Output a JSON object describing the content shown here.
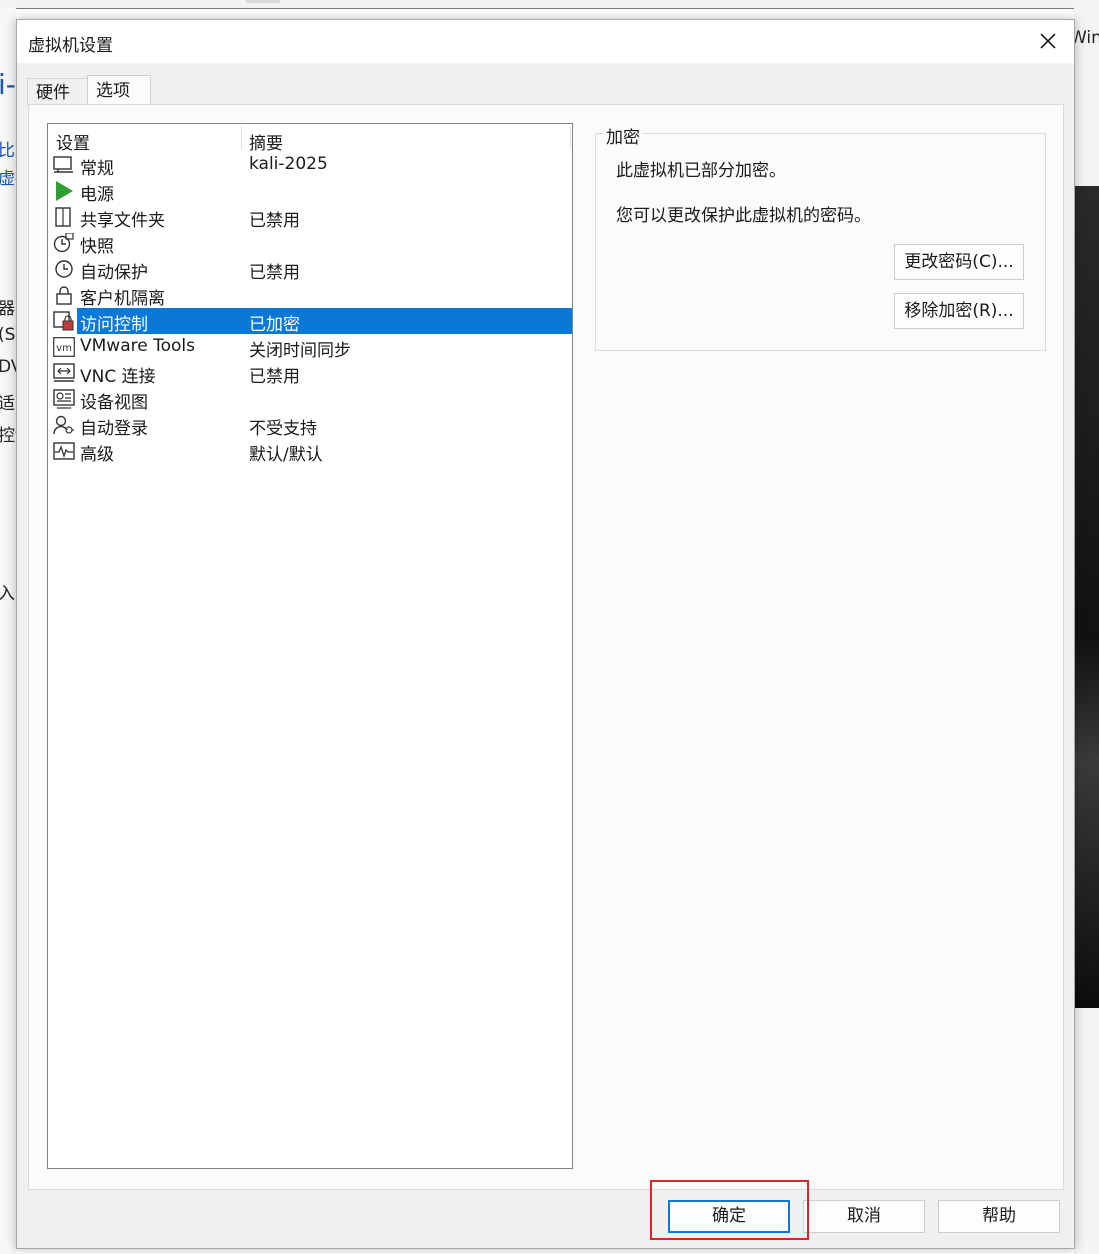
{
  "background": {
    "left_fragments": [
      "i-",
      "比虚",
      "虚拟",
      "器",
      "(S",
      "DV",
      "适配",
      "控制",
      "入"
    ],
    "right_fragment": "Wind"
  },
  "dialog": {
    "title": "虚拟机设置",
    "tabs": [
      {
        "label": "硬件",
        "active": false
      },
      {
        "label": "选项",
        "active": true
      }
    ],
    "list": {
      "header": {
        "setting": "设置",
        "summary": "摘要"
      },
      "rows": [
        {
          "name": "常规",
          "summary": "kali-2025",
          "icon": "general-icon"
        },
        {
          "name": "电源",
          "summary": "",
          "icon": "power-icon"
        },
        {
          "name": "共享文件夹",
          "summary": "已禁用",
          "icon": "shared-folder-icon"
        },
        {
          "name": "快照",
          "summary": "",
          "icon": "snapshot-icon"
        },
        {
          "name": "自动保护",
          "summary": "已禁用",
          "icon": "autoprotect-icon"
        },
        {
          "name": "客户机隔离",
          "summary": "",
          "icon": "lock-icon"
        },
        {
          "name": "访问控制",
          "summary": "已加密",
          "icon": "access-control-icon",
          "selected": true
        },
        {
          "name": "VMware Tools",
          "summary": "关闭时间同步",
          "icon": "vmware-tools-icon"
        },
        {
          "name": "VNC 连接",
          "summary": "已禁用",
          "icon": "vnc-icon"
        },
        {
          "name": "设备视图",
          "summary": "",
          "icon": "device-view-icon"
        },
        {
          "name": "自动登录",
          "summary": "不受支持",
          "icon": "autologin-icon"
        },
        {
          "name": "高级",
          "summary": "默认/默认",
          "icon": "advanced-icon"
        }
      ]
    },
    "encryption": {
      "title": "加密",
      "status": "此虚拟机已部分加密。",
      "hint": "您可以更改保护此虚拟机的密码。",
      "change_password": "更改密码(C)...",
      "remove_encryption": "移除加密(R)..."
    },
    "footer": {
      "ok": "确定",
      "cancel": "取消",
      "help": "帮助"
    }
  },
  "colors": {
    "selection": "#0a78d7",
    "highlight_outline": "#d9262c",
    "power_green": "#2e9e33"
  }
}
